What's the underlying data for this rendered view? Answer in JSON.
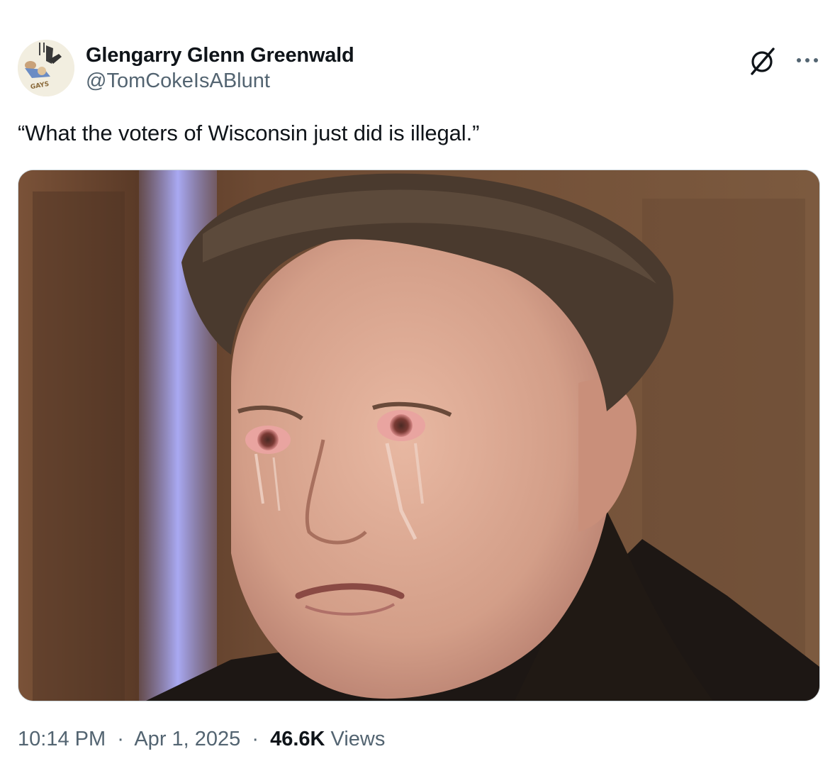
{
  "tweet": {
    "author": {
      "display_name": "Glengarry Glenn Greenwald",
      "handle": "@TomCokeIsABlunt",
      "avatar_label": "GAYS"
    },
    "text": "“What the voters of Wisconsin just did is illegal.”",
    "media": {
      "alt": "Photo of a crying man with red eyes"
    },
    "meta": {
      "time": "10:14 PM",
      "separator": "·",
      "date": "Apr 1, 2025",
      "views_count": "46.6K",
      "views_label": "Views"
    },
    "icons": {
      "grok": "grok-icon",
      "more": "more-icon"
    },
    "colors": {
      "text": "#0f1419",
      "secondary": "#536471",
      "border": "#cfd9de"
    }
  }
}
